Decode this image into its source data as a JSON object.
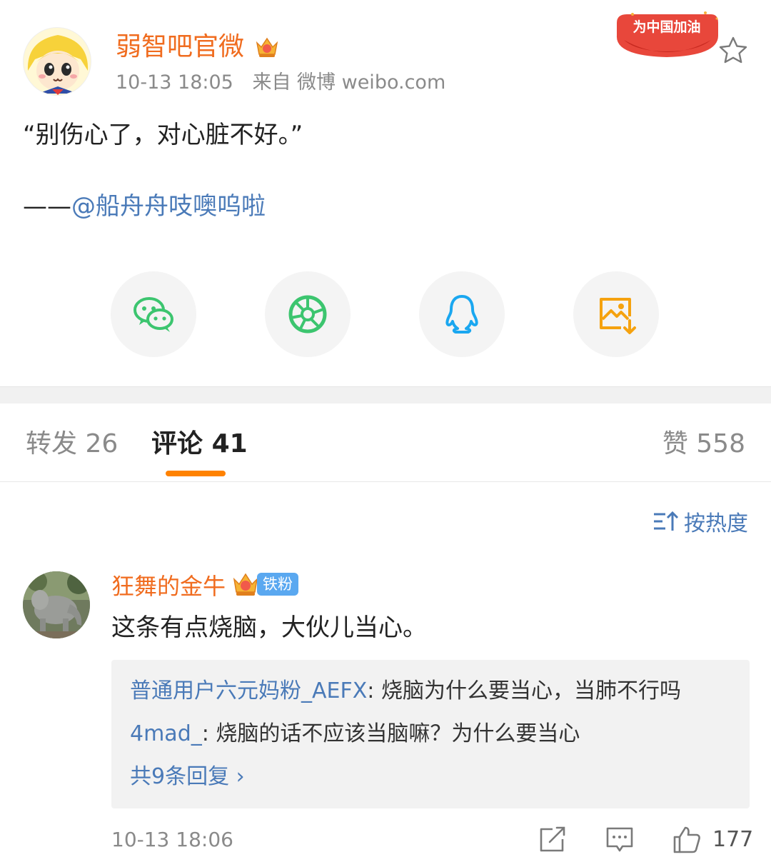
{
  "post": {
    "author_name": "弱智吧官微",
    "time": "10-13 18:05",
    "source": "来自 微博 weibo.com",
    "campaign_badge_text": "为中国加油",
    "text": "“别伤心了，对心脏不好。”",
    "credit_prefix": "——",
    "credit_mention": "@船舟舟吱噢呜啦",
    "share_buttons": [
      "wechat-icon",
      "moments-icon",
      "qq-icon",
      "save-image-icon"
    ]
  },
  "tabs": {
    "repost_label": "转发",
    "repost_count": "26",
    "comments_label": "评论",
    "comments_count": "41",
    "likes_label": "赞",
    "likes_count": "558"
  },
  "sort": {
    "label": "按热度"
  },
  "comment": {
    "author_name": "狂舞的金牛",
    "fan_badge": "铁粉",
    "text": "这条有点烧脑，大伙儿当心。",
    "replies": [
      {
        "user": "普通用户六元妈粉_AEFX",
        "text": ": 烧脑为什么要当心，当肺不行吗"
      },
      {
        "user": "4mad_",
        "text": ": 烧脑的话不应该当脑嘛？为什么要当心"
      }
    ],
    "more_replies": "共9条回复 ",
    "more_chevron": "›",
    "time": "10-13 18:06",
    "like_count": "177"
  },
  "colors": {
    "username_orange": "#f06c1f",
    "link_blue": "#4a7ab8",
    "tab_accent": "#ff8200",
    "wechat_green": "#3cc56f",
    "qq_blue": "#1aa7f0",
    "save_orange": "#f5a20f"
  }
}
